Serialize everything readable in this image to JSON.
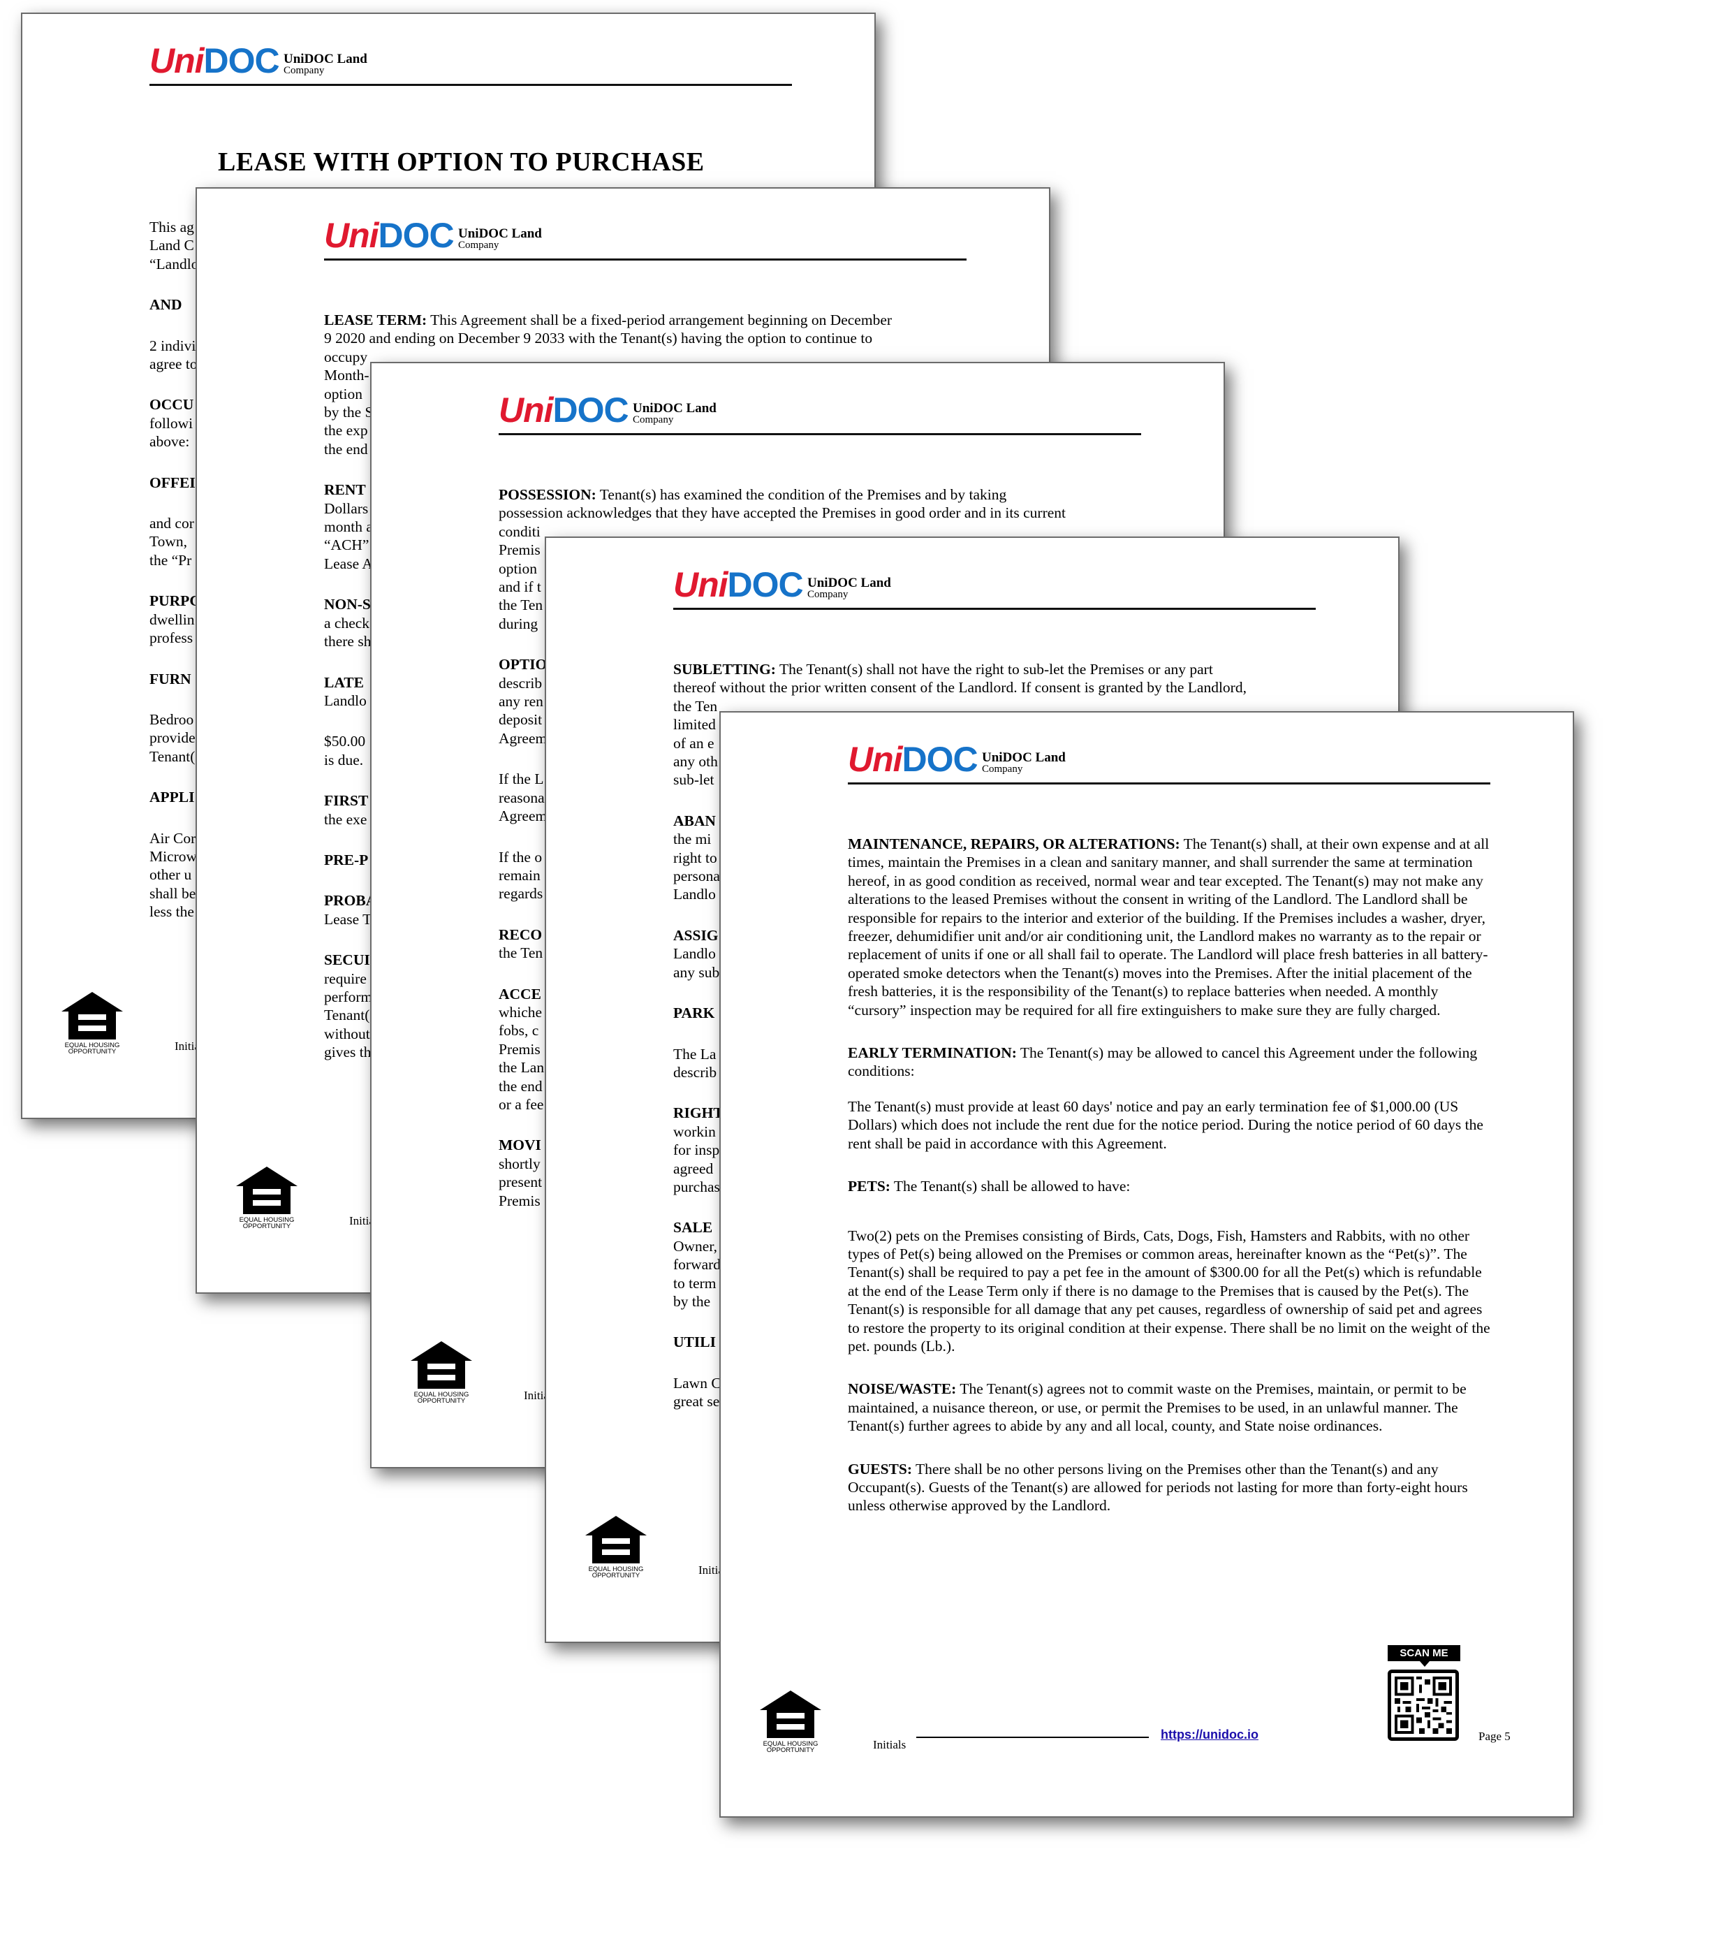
{
  "brand": {
    "logo_uni": "Uni",
    "logo_doc": "DOC",
    "company_line1": "UniDOC Land",
    "company_line2": "Company",
    "logo_red": "#e0192f",
    "logo_blue": "#1673c9"
  },
  "eho_label": "EQUAL HOUSING OPPORTUNITY",
  "initials_label": "Initials",
  "pages": [
    {
      "title": "LEASE WITH OPTION TO PURCHASE",
      "lines": [
        "This ag",
        "Land C",
        "“Landlo",
        "AND",
        "2 indivi",
        "agree to",
        "OCCU",
        "followi",
        "above:",
        "OFFEI",
        "and cor",
        "Town,",
        "the “Pr",
        "PURPC",
        "dwellin",
        "profess",
        "FURN",
        "Bedroo",
        "provide",
        "Tenant(",
        "APPLI",
        "Air Cor",
        "Microw",
        "other u",
        "shall be",
        "less the"
      ]
    },
    {
      "line1_head": "LEASE TERM:",
      "line1_text": " This Agreement shall be a fixed-period arrangement beginning on December",
      "line2": "9 2020 and ending on December 9 2033 with the Tenant(s) having the option to continue to",
      "lines": [
        "occupy",
        "Month-",
        "option",
        "by the S",
        "the exp",
        "the end",
        "RENT",
        "Dollars",
        "month a",
        "“ACH”",
        "Lease A",
        "NON-S",
        "a check",
        "there sh",
        "LATE",
        "Landlo",
        "$50.00",
        "is due.",
        "FIRST",
        "the exe",
        "PRE-P",
        "PROBA",
        "Lease T",
        "SECUI",
        "require",
        "perform",
        "Tenant(",
        "without",
        "gives th"
      ]
    },
    {
      "line1_head": "POSSESSION:",
      "line1_text": " Tenant(s) has examined the condition of the Premises and by taking",
      "line2": "possession acknowledges that they have accepted the Premises in good order and in its current",
      "lines": [
        "conditi",
        "Premis",
        "option",
        "and if t",
        "the Ten",
        "during",
        "OPTIO",
        "describ",
        "any ren",
        "deposit",
        "Agreem",
        "If the L",
        "reasona",
        "Agreem",
        "If the o",
        "remain",
        "regards",
        "RECO",
        "the Ten",
        "ACCE",
        "whiche",
        "fobs, c",
        "Premis",
        "the Lan",
        "the end",
        "or a fee",
        "MOVI",
        "shortly",
        "present",
        "Premis"
      ]
    },
    {
      "line1_head": "SUBLETTING:",
      "line1_text": " The Tenant(s) shall not have the right to sub-let the Premises or any part",
      "line2": "thereof without the prior written consent of the Landlord. If consent is granted by the Landlord,",
      "lines": [
        "the Ten",
        "limited",
        "of an e",
        "any oth",
        "sub-let",
        "ABAN",
        "the mi",
        "right to",
        "persona",
        "Landlo",
        "ASSIG",
        "Landlo",
        "any sub",
        "PARK",
        "The La",
        "describ",
        "RIGHT",
        "workin",
        "for insp",
        "agreed",
        "purchas",
        "SALE",
        "Owner,",
        "forward",
        "to term",
        "by the",
        "UTILI",
        "Lawn C",
        "great se"
      ]
    },
    {
      "sections": [
        {
          "head": "MAINTENANCE, REPAIRS, OR ALTERATIONS:",
          "text": " The Tenant(s) shall, at their own expense and at all times, maintain the Premises in a clean and sanitary manner, and shall surrender the same at termination hereof, in as good condition as received, normal wear and tear excepted. The Tenant(s) may not make any alterations to the leased Premises without the consent in writing of the Landlord. The Landlord shall be responsible for repairs to the interior and exterior of the building. If the Premises includes a washer, dryer, freezer, dehumidifier unit and/or air conditioning unit, the Landlord makes no warranty as to the repair or replacement of units if one or all shall fail to operate. The Landlord will place fresh batteries in all battery-operated smoke detectors when the Tenant(s) moves into the Premises. After the initial placement of the fresh batteries, it is the responsibility of the Tenant(s) to replace batteries when needed. A monthly “cursory” inspection may be required for all fire extinguishers to make sure they are fully charged."
        },
        {
          "head": "EARLY TERMINATION:",
          "text": " The Tenant(s) may be allowed to cancel this Agreement under the following conditions:"
        },
        {
          "head": "",
          "text": "The Tenant(s) must provide at least 60 days' notice and pay an early termination fee of $1,000.00 (US Dollars) which does not include the rent due for the notice period. During the notice period of 60 days the rent shall be paid in accordance with this Agreement."
        },
        {
          "head": "PETS:",
          "text": " The Tenant(s) shall be allowed to have:"
        },
        {
          "head": "",
          "text": "Two(2) pets on the Premises consisting of Birds, Cats, Dogs, Fish, Hamsters and Rabbits, with no other types of Pet(s) being allowed on the Premises or common areas, hereinafter known as the “Pet(s)”. The Tenant(s) shall be required to pay a pet fee in the amount of $300.00 for all the Pet(s) which is refundable at the end of the Lease Term only if there is no damage to the Premises that is caused by the Pet(s). The Tenant(s) is responsible for all damage that any pet causes, regardless of ownership of said pet and agrees to restore the property to its original condition at their expense. There shall be no limit on the weight of the pet. pounds (Lb.)."
        },
        {
          "head": "NOISE/WASTE:",
          "text": " The Tenant(s) agrees not to commit waste on the Premises, maintain, or permit to be maintained, a nuisance thereon, or use, or permit the Premises to be used, in an unlawful manner. The Tenant(s) further agrees to abide by any and all local, county, and State noise ordinances."
        },
        {
          "head": "GUESTS:",
          "text": " There shall be no other persons living on the Premises other than the Tenant(s) and any Occupant(s). Guests of the Tenant(s) are allowed for periods not lasting for more than forty-eight hours unless otherwise approved by the Landlord."
        }
      ],
      "scan_me": "SCAN ME",
      "link": "https://unidoc.io",
      "page_label": "Page 5"
    }
  ]
}
